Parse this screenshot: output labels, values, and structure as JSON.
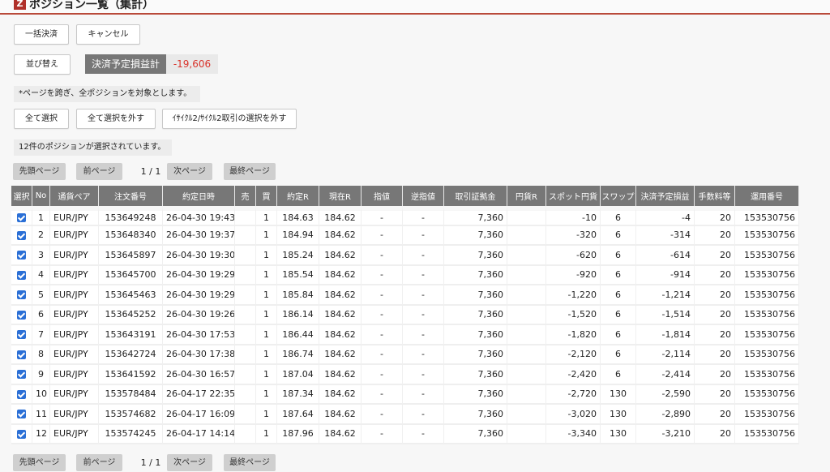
{
  "title": {
    "icon": "Z",
    "text": "ポジション一覧（集計）"
  },
  "buttons": {
    "bulk_settle": "一括決済",
    "cancel": "キャンセル",
    "sort": "並び替え",
    "select_all": "全て選択",
    "deselect_all": "全て選択を外す",
    "deselect_cycle": "ｲｻｲｸﾙ2/ｻｲｸﾙ2取引の選択を外す"
  },
  "summary": {
    "label": "決済予定損益計",
    "value": "-19,606"
  },
  "notes": {
    "cross_page": "*ページを跨ぎ、全ポジションを対象とします。",
    "selected_count": "12件のポジションが選択されています。"
  },
  "pager": {
    "first": "先頭ページ",
    "prev": "前ページ",
    "info": "1 / 1",
    "next": "次ページ",
    "last": "最終ページ"
  },
  "table": {
    "headers": [
      "選択",
      "No",
      "通貨ペア",
      "注文番号",
      "約定日時",
      "売",
      "買",
      "約定R",
      "現在R",
      "指値",
      "逆指値",
      "取引証拠金",
      "円貨R",
      "スポット円貨",
      "スワップ",
      "決済予定損益",
      "手数料等",
      "運用番号"
    ],
    "rows": [
      [
        "1",
        "EUR/JPY",
        "153649248",
        "26-04-30 19:43",
        "",
        "1",
        "184.63",
        "184.62",
        "-",
        "-",
        "7,360",
        "",
        "-10",
        "6",
        "-4",
        "20",
        "153530756"
      ],
      [
        "2",
        "EUR/JPY",
        "153648340",
        "26-04-30 19:37",
        "",
        "1",
        "184.94",
        "184.62",
        "-",
        "-",
        "7,360",
        "",
        "-320",
        "6",
        "-314",
        "20",
        "153530756"
      ],
      [
        "3",
        "EUR/JPY",
        "153645897",
        "26-04-30 19:30",
        "",
        "1",
        "185.24",
        "184.62",
        "-",
        "-",
        "7,360",
        "",
        "-620",
        "6",
        "-614",
        "20",
        "153530756"
      ],
      [
        "4",
        "EUR/JPY",
        "153645700",
        "26-04-30 19:29",
        "",
        "1",
        "185.54",
        "184.62",
        "-",
        "-",
        "7,360",
        "",
        "-920",
        "6",
        "-914",
        "20",
        "153530756"
      ],
      [
        "5",
        "EUR/JPY",
        "153645463",
        "26-04-30 19:29",
        "",
        "1",
        "185.84",
        "184.62",
        "-",
        "-",
        "7,360",
        "",
        "-1,220",
        "6",
        "-1,214",
        "20",
        "153530756"
      ],
      [
        "6",
        "EUR/JPY",
        "153645252",
        "26-04-30 19:26",
        "",
        "1",
        "186.14",
        "184.62",
        "-",
        "-",
        "7,360",
        "",
        "-1,520",
        "6",
        "-1,514",
        "20",
        "153530756"
      ],
      [
        "7",
        "EUR/JPY",
        "153643191",
        "26-04-30 17:53",
        "",
        "1",
        "186.44",
        "184.62",
        "-",
        "-",
        "7,360",
        "",
        "-1,820",
        "6",
        "-1,814",
        "20",
        "153530756"
      ],
      [
        "8",
        "EUR/JPY",
        "153642724",
        "26-04-30 17:38",
        "",
        "1",
        "186.74",
        "184.62",
        "-",
        "-",
        "7,360",
        "",
        "-2,120",
        "6",
        "-2,114",
        "20",
        "153530756"
      ],
      [
        "9",
        "EUR/JPY",
        "153641592",
        "26-04-30 16:57",
        "",
        "1",
        "187.04",
        "184.62",
        "-",
        "-",
        "7,360",
        "",
        "-2,420",
        "6",
        "-2,414",
        "20",
        "153530756"
      ],
      [
        "10",
        "EUR/JPY",
        "153578484",
        "26-04-17 22:35",
        "",
        "1",
        "187.34",
        "184.62",
        "-",
        "-",
        "7,360",
        "",
        "-2,720",
        "130",
        "-2,590",
        "20",
        "153530756"
      ],
      [
        "11",
        "EUR/JPY",
        "153574682",
        "26-04-17 16:09",
        "",
        "1",
        "187.64",
        "184.62",
        "-",
        "-",
        "7,360",
        "",
        "-3,020",
        "130",
        "-2,890",
        "20",
        "153530756"
      ],
      [
        "12",
        "EUR/JPY",
        "153574245",
        "26-04-17 14:14",
        "",
        "1",
        "187.96",
        "184.62",
        "-",
        "-",
        "7,360",
        "",
        "-3,340",
        "130",
        "-3,210",
        "20",
        "153530756"
      ]
    ]
  },
  "colors": {
    "accent": "#b94a3a",
    "negative": "#d9332b",
    "header_bg": "#777777",
    "checkbox": "#2a6fd6"
  }
}
